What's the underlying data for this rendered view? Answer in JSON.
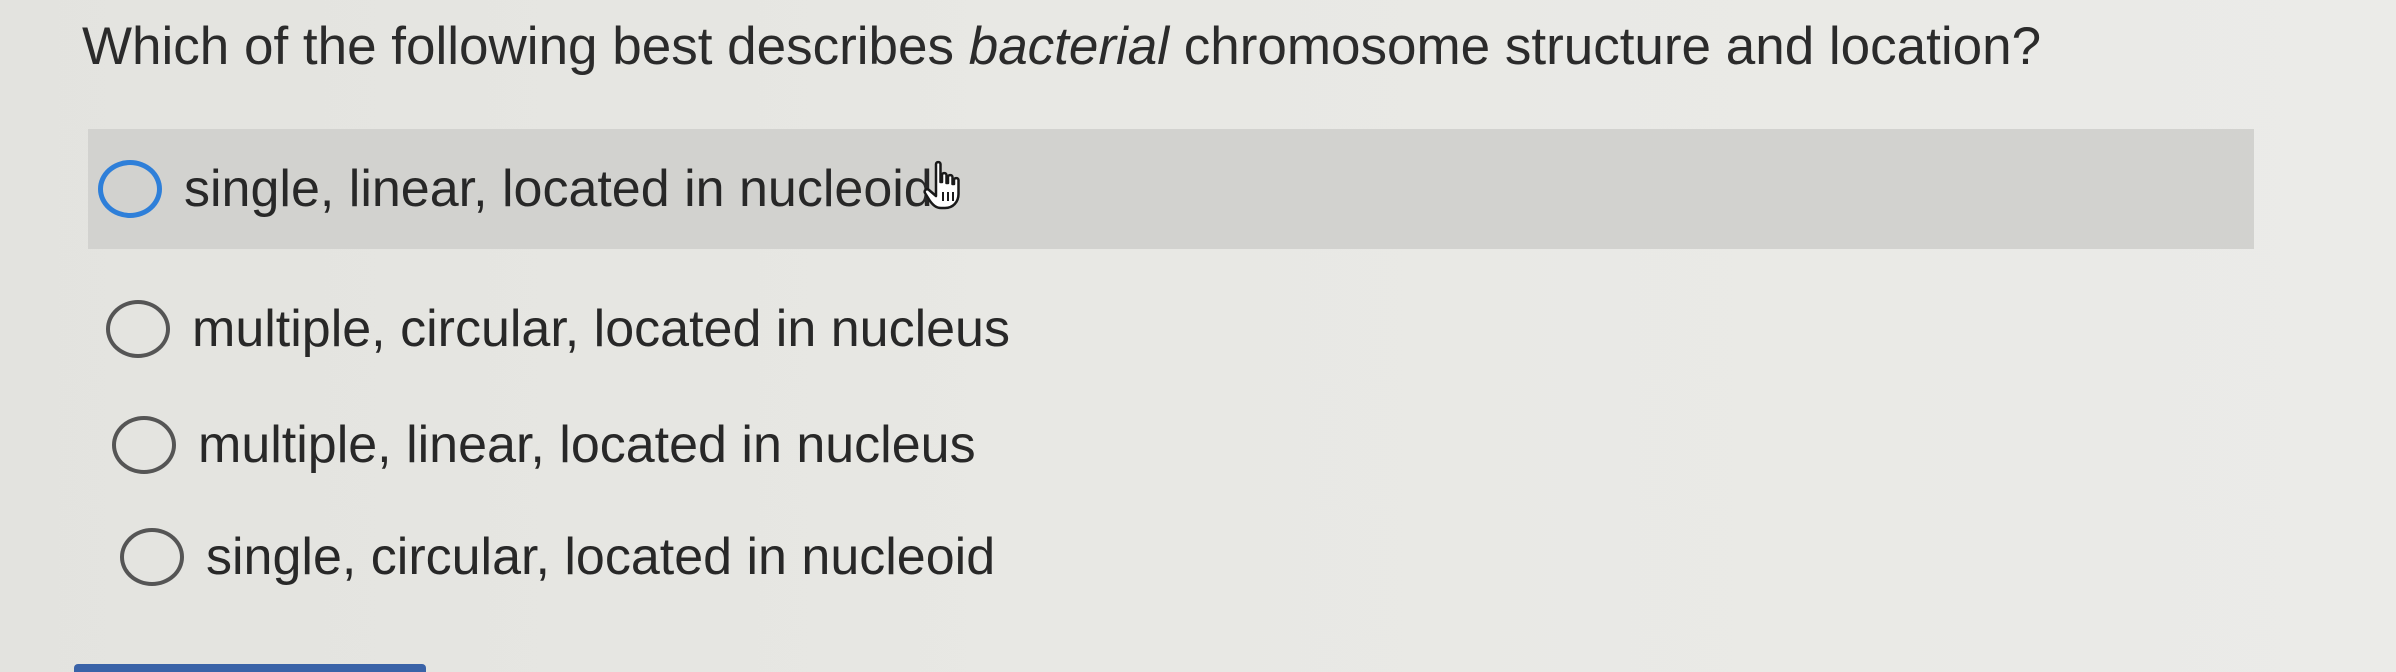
{
  "question": {
    "prefix": "Which of the following best describes ",
    "emphasis": "bacterial",
    "suffix": " chromosome structure and location?"
  },
  "options": [
    {
      "label": "single, linear, located in nucleoid",
      "highlighted": true
    },
    {
      "label": "multiple, circular, located in nucleus",
      "highlighted": false
    },
    {
      "label": "multiple, linear, located in nucleus",
      "highlighted": false
    },
    {
      "label": "single, circular, located in nucleoid",
      "highlighted": false
    }
  ],
  "colors": {
    "highlight_row": "#d2d2cf",
    "focus_ring": "#2e7fd9",
    "bottom_accent": "#3a63a8"
  },
  "icons": {
    "cursor": "hand-pointer-icon"
  }
}
